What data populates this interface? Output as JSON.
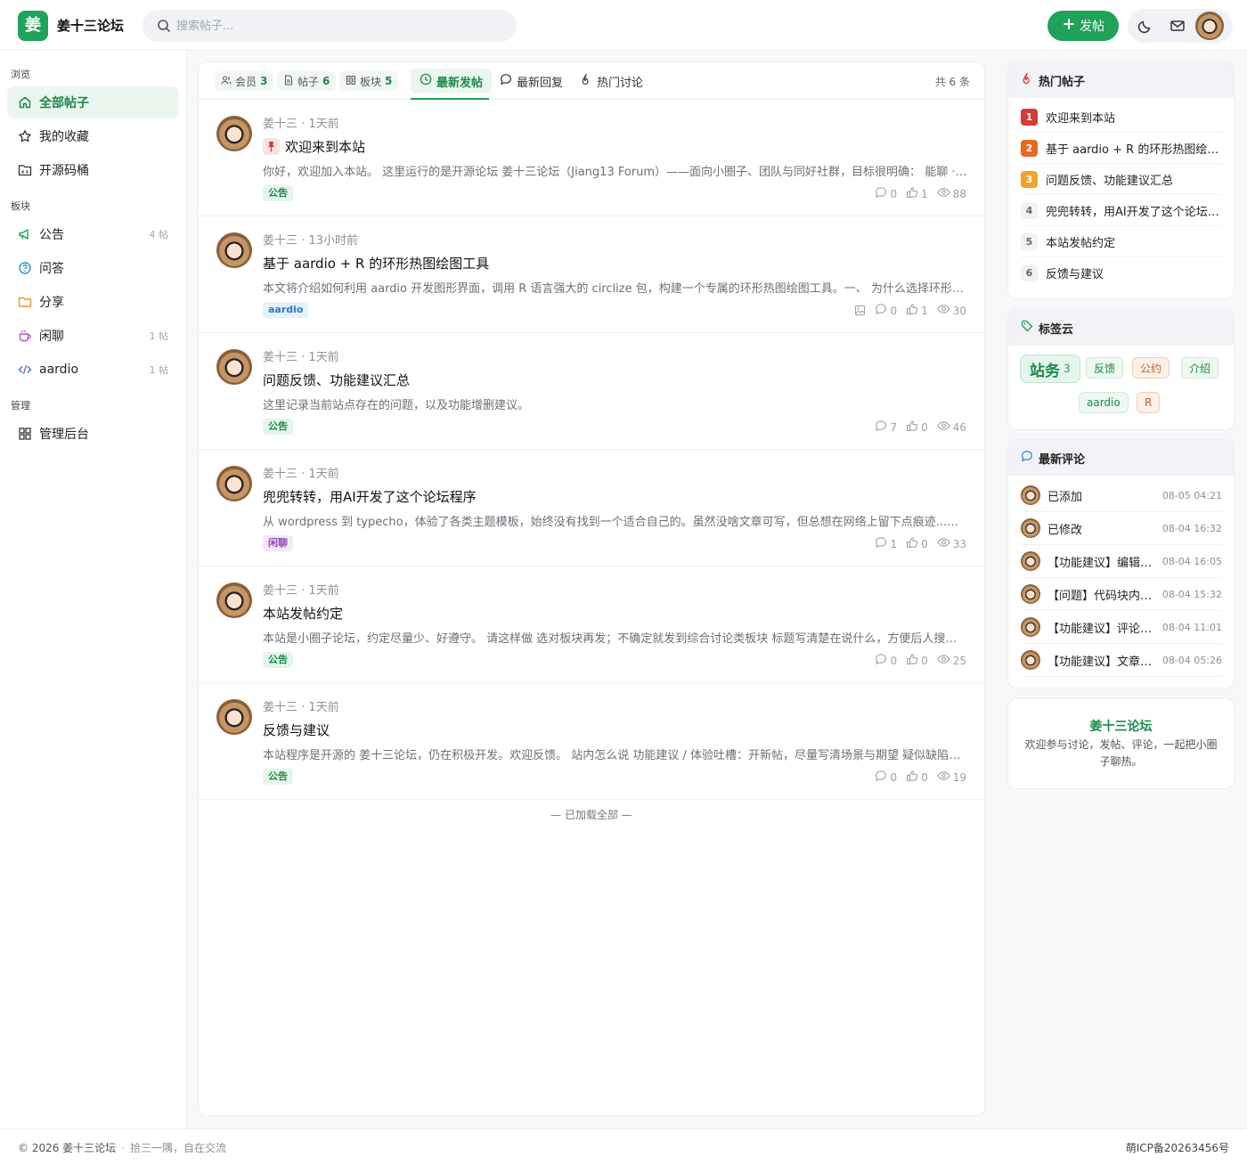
{
  "header": {
    "logo_char": "姜",
    "site_name": "姜十三论坛",
    "search_placeholder": "搜索帖子...",
    "post_button": "发帖",
    "brand_color": "#1fa25a"
  },
  "left_nav": {
    "sections": [
      "浏览",
      "板块",
      "管理"
    ],
    "browse": [
      {
        "label": "全部帖子",
        "icon": "home-icon",
        "active": true
      },
      {
        "label": "我的收藏",
        "icon": "star-icon"
      },
      {
        "label": "开源码桶",
        "icon": "code-folder-icon"
      }
    ],
    "boards": [
      {
        "label": "公告",
        "icon": "megaphone-icon",
        "count": "4 帖"
      },
      {
        "label": "问答",
        "icon": "question-icon",
        "count": ""
      },
      {
        "label": "分享",
        "icon": "folder-icon",
        "count": ""
      },
      {
        "label": "闲聊",
        "icon": "coffee-icon",
        "count": "1 帖"
      },
      {
        "label": "aardio",
        "icon": "code-icon",
        "count": "1 帖"
      }
    ],
    "admin": [
      {
        "label": "管理后台",
        "icon": "grid-icon"
      }
    ]
  },
  "main": {
    "stats": [
      {
        "label": "会员",
        "value": "3",
        "icon": "users-icon"
      },
      {
        "label": "帖子",
        "value": "6",
        "icon": "file-icon"
      },
      {
        "label": "板块",
        "value": "5",
        "icon": "grid-icon"
      }
    ],
    "tabs": [
      {
        "label": "最新发帖",
        "icon": "clock-icon",
        "active": true
      },
      {
        "label": "最新回复",
        "icon": "comment-icon"
      },
      {
        "label": "热门讨论",
        "icon": "flame-icon"
      }
    ],
    "total": "共 6 条",
    "posts": [
      {
        "author": "姜十三",
        "time": "1天前",
        "pinned": true,
        "title": "欢迎来到本站",
        "excerpt": "你好，欢迎加入本站。 这里运行的是开源论坛 姜十三论坛（Jiang13 Forum）——面向小圈子、团队与同好社群，目标很明确： 能聊 · 能搜 · 能沉淀",
        "tag": "公告",
        "tag_style": "green",
        "has_image": false,
        "comments": "0",
        "likes": "1",
        "views": "88"
      },
      {
        "author": "姜十三",
        "time": "13小时前",
        "pinned": false,
        "title": "基于 aardio + R 的环形热图绘图工具",
        "excerpt": "本文将介绍如何利用 aardio 开发图形界面，调用 R 语言强大的 circlize 包，构建一个专属的环形热图绘图工具。一、 为什么选择环形热图",
        "tag": "aardio",
        "tag_style": "blue",
        "has_image": true,
        "comments": "0",
        "likes": "1",
        "views": "30"
      },
      {
        "author": "姜十三",
        "time": "1天前",
        "pinned": false,
        "title": "问题反馈、功能建议汇总",
        "excerpt": "这里记录当前站点存在的问题，以及功能增删建议。",
        "tag": "公告",
        "tag_style": "green",
        "has_image": false,
        "comments": "7",
        "likes": "0",
        "views": "46"
      },
      {
        "author": "姜十三",
        "time": "1天前",
        "pinned": false,
        "title": "兜兜转转，用AI开发了这个论坛程序",
        "excerpt": "从 wordpress 到 typecho，体验了各类主题模板，始终没有找到一个适合自己的。虽然没啥文章可写，但总想在网络上留下点痕迹...修改了无数次",
        "tag": "闲聊",
        "tag_style": "purple",
        "has_image": false,
        "comments": "1",
        "likes": "0",
        "views": "33"
      },
      {
        "author": "姜十三",
        "time": "1天前",
        "pinned": false,
        "title": "本站发帖约定",
        "excerpt": "本站是小圈子论坛，约定尽量少、好遵守。 请这样做 选对板块再发；不确定就发到综合讨论类板块 标题写清楚在说什么，方便后人搜索和查找",
        "tag": "公告",
        "tag_style": "green",
        "has_image": false,
        "comments": "0",
        "likes": "0",
        "views": "25"
      },
      {
        "author": "姜十三",
        "time": "1天前",
        "pinned": false,
        "title": "反馈与建议",
        "excerpt": "本站程序是开源的 姜十三论坛，仍在积极开发。欢迎反馈。 站内怎么说 功能建议 / 体验吐槽：开新帖，尽量写清场景与期望 疑似缺陷：写清楚复现步骤",
        "tag": "公告",
        "tag_style": "green",
        "has_image": false,
        "comments": "0",
        "likes": "0",
        "views": "19"
      }
    ],
    "loaded_all": "— 已加载全部 —"
  },
  "hot_posts": {
    "title": "热门帖子",
    "items": [
      {
        "rank": "1",
        "title": "欢迎来到本站"
      },
      {
        "rank": "2",
        "title": "基于 aardio + R 的环形热图绘图工具"
      },
      {
        "rank": "3",
        "title": "问题反馈、功能建议汇总"
      },
      {
        "rank": "4",
        "title": "兜兜转转，用AI开发了这个论坛程序"
      },
      {
        "rank": "5",
        "title": "本站发帖约定"
      },
      {
        "rank": "6",
        "title": "反馈与建议"
      }
    ]
  },
  "tag_cloud": {
    "title": "标签云",
    "main_tag": {
      "label": "站务",
      "count": "3"
    },
    "tags": [
      {
        "label": "反馈",
        "color": "#1a8a4a"
      },
      {
        "label": "公约",
        "color": "#c0622a"
      },
      {
        "label": "介绍",
        "color": "#1a8a4a"
      },
      {
        "label": "aardio",
        "color": "#1a8a4a"
      },
      {
        "label": "R",
        "color": "#c0622a"
      }
    ]
  },
  "recent_comments": {
    "title": "最新评论",
    "items": [
      {
        "text": "已添加",
        "time": "08-05 04:21"
      },
      {
        "text": "已修改",
        "time": "08-04 16:32"
      },
      {
        "text": "【功能建议】编辑帖子",
        "time": "08-04 16:05"
      },
      {
        "text": "【问题】代码块内容显示",
        "time": "08-04 15:32"
      },
      {
        "text": "【功能建议】评论区优化",
        "time": "08-04 11:01"
      },
      {
        "text": "【功能建议】文章目录",
        "time": "08-04 05:26"
      }
    ]
  },
  "about": {
    "title": "姜十三论坛",
    "text": "欢迎参与讨论，发帖、评论，一起把小圈子聊热。"
  },
  "footer": {
    "copyright": "© 2026 姜十三论坛",
    "separator": "·",
    "slogan": "拾三一隅，自在交流",
    "icp": "萌ICP备20263456号"
  }
}
